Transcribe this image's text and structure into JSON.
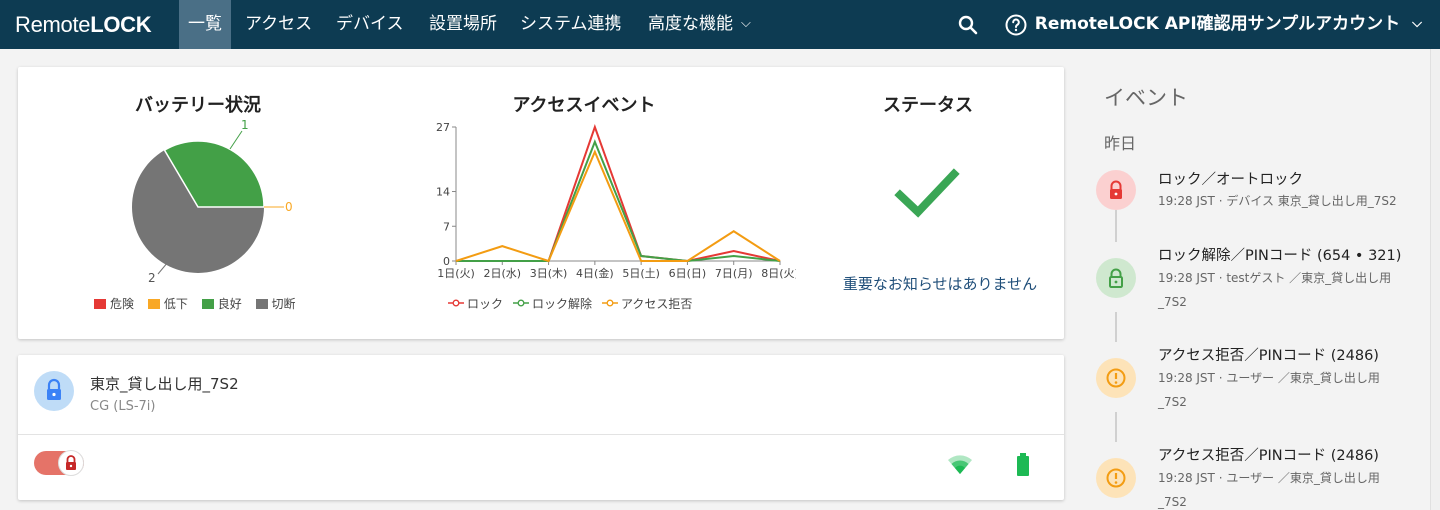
{
  "header": {
    "logo_remote": "Remote",
    "logo_lock": "LOCK",
    "nav": [
      "一覧",
      "アクセス",
      "デバイス",
      "設置場所",
      "システム連携",
      "高度な機能"
    ],
    "account": "RemoteLOCK API確認用サンプルアカウント",
    "search_icon": "search-icon",
    "help_icon": "help-icon"
  },
  "battery": {
    "title": "バッテリー状況",
    "slice_labels": {
      "good": "1",
      "low": "0",
      "disconnected": "2"
    },
    "legend": [
      "危険",
      "低下",
      "良好",
      "切断"
    ],
    "colors": {
      "danger": "#e53935",
      "low": "#f9a825",
      "good": "#43a047",
      "disconnected": "#757575"
    }
  },
  "chart_data": {
    "type": "line",
    "title": "アクセスイベント",
    "categories": [
      "1日(火)",
      "2日(水)",
      "3日(木)",
      "4日(金)",
      "5日(土)",
      "6日(日)",
      "7日(月)",
      "8日(火)"
    ],
    "yticks": [
      "0",
      "7",
      "14",
      "27"
    ],
    "ylim": [
      0,
      27
    ],
    "series": [
      {
        "name": "ロック",
        "color": "#e53935",
        "values": [
          0,
          0,
          0,
          27,
          1,
          0,
          2,
          0
        ]
      },
      {
        "name": "ロック解除",
        "color": "#43a047",
        "values": [
          0,
          0,
          0,
          24,
          1,
          0,
          1,
          0
        ]
      },
      {
        "name": "アクセス拒否",
        "color": "#f39c12",
        "values": [
          0,
          3,
          0,
          22,
          0,
          0,
          6,
          0
        ]
      }
    ]
  },
  "status": {
    "title": "ステータス",
    "message": "重要なお知らせはありません",
    "check_color": "#3aa655"
  },
  "device": {
    "name": "東京_貸し出し用_7S2",
    "model": "CG (LS-7i)",
    "wifi_icon": "wifi-icon",
    "battery_icon": "battery-full-icon"
  },
  "events": {
    "title": "イベント",
    "day": "昨日",
    "items": [
      {
        "title": "ロック／オートロック",
        "subtitle": "19:28 JST · デバイス 東京_貸し出し用_7S2",
        "icon": "lock-icon",
        "color": "#e53935",
        "bg": "#fbd0d0"
      },
      {
        "title": "ロック解除／PINコード (654 • 321)",
        "subtitle": "19:28 JST · testゲスト ／東京_貸し出し用_7S2",
        "icon": "unlock-icon",
        "color": "#43a047",
        "bg": "#cfe8cf"
      },
      {
        "title": "アクセス拒否／PINコード (2486)",
        "subtitle": "19:28 JST · ユーザー ／東京_貸し出し用_7S2",
        "icon": "warning-icon",
        "color": "#f39c12",
        "bg": "#fde3b8"
      },
      {
        "title": "アクセス拒否／PINコード (2486)",
        "subtitle": "19:28 JST · ユーザー ／東京_貸し出し用_7S2",
        "icon": "warning-icon",
        "color": "#f39c12",
        "bg": "#fde3b8"
      }
    ]
  }
}
